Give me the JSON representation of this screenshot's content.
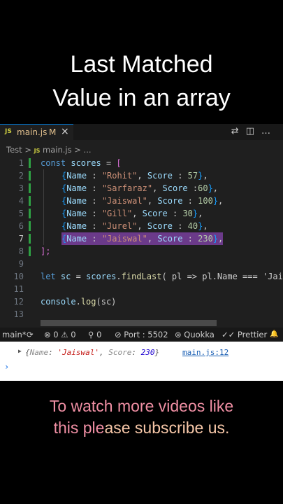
{
  "caption_top": {
    "line1": "Last Matched",
    "line2": "Value in an array"
  },
  "tab": {
    "lang": "JS",
    "name": "main.js",
    "modified": "M",
    "close": "×"
  },
  "tab_icons": [
    "⇄",
    "◫",
    "…"
  ],
  "breadcrumb": {
    "folder": "Test",
    "sep": ">",
    "lang": "JS",
    "file": "main.js",
    "sep2": ">",
    "more": "..."
  },
  "code": {
    "line_numbers": [
      "1",
      "2",
      "3",
      "4",
      "5",
      "6",
      "7",
      "8",
      "9",
      "10",
      "11",
      "12",
      "13"
    ],
    "l1": {
      "kw": "const",
      "var": "scores",
      "eq": " = ",
      "br": "["
    },
    "rows": [
      {
        "name": "\"Rohit\"",
        "score": "57",
        "text_a": "{",
        "text_b": "Name : ",
        "text_c": ", Score : ",
        "text_d": "},",
        "open": "{"
      },
      {
        "name": "\"Sarfaraz\"",
        "score": "60"
      },
      {
        "name": "\"Jaiswal\"",
        "score": "100"
      },
      {
        "name": "\"Gill\"",
        "score": "30"
      },
      {
        "name": "\"Jurel\"",
        "score": "40"
      },
      {
        "name": "\"Jaiswal\"",
        "score": "230"
      }
    ],
    "l8": "];",
    "l10": {
      "kw": "let",
      "var": "sc",
      "eq": " = ",
      "obj": "scores",
      "dot": ".",
      "fn": "findLast",
      "rest": "( pl => pl.Name === 'Jais"
    },
    "l12": {
      "obj": "console",
      "dot": ".",
      "fn": "log",
      "rest": "(sc)"
    }
  },
  "statusbar": {
    "branch": "main*",
    "sync": "⟳",
    "errors": "⊗ 0 ⚠ 0",
    "ports": "⚲ 0",
    "port": "⊘ Port : 5502",
    "quokka": "⊚ Quokka",
    "prettier": "✓✓ Prettier",
    "bell": "🔔"
  },
  "console": {
    "expand": "▶",
    "open": "{",
    "k1": "Name",
    "colon": ": ",
    "v1": "'Jaiswal'",
    "comma": ", ",
    "k2": "Score",
    "v2": "230",
    "close": "}",
    "link": "main.js:12",
    "prompt": "›"
  },
  "caption_bottom": {
    "line1": "To watch more videos like",
    "line2_a": "this ple",
    "line2_b": "ase subscribe us."
  }
}
